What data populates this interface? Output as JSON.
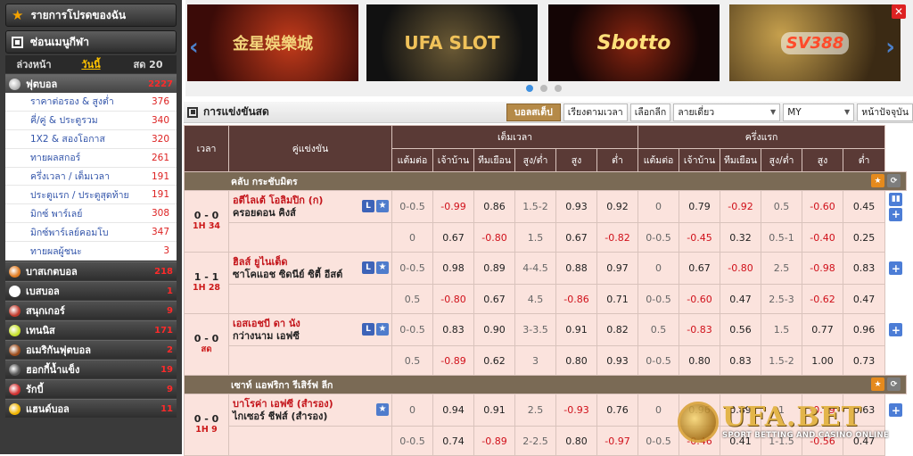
{
  "sidebar": {
    "favorites_label": "รายการโปรดของฉัน",
    "hide_menu_label": "ซ่อนเมนูกีฬา",
    "tabs": [
      {
        "label": "ล่วงหน้า",
        "active": false
      },
      {
        "label": "วันนี้",
        "active": true
      },
      {
        "label": "สด 20",
        "active": false
      }
    ],
    "active_sport": {
      "label": "ฟุตบอล",
      "count": "2227",
      "icon_color": "#ffffff"
    },
    "football_subs": [
      {
        "label": "ราคาต่อรอง & สูงต่ำ",
        "count": "376"
      },
      {
        "label": "คี่/คู่ & ประตูรวม",
        "count": "340"
      },
      {
        "label": "1X2 & สองโอกาส",
        "count": "320"
      },
      {
        "label": "ทายผลสกอร์",
        "count": "261"
      },
      {
        "label": "ครึ่งเวลา / เต็มเวลา",
        "count": "191"
      },
      {
        "label": "ประตูแรก / ประตูสุดท้าย",
        "count": "191"
      },
      {
        "label": "มิกซ์ พาร์เลย์",
        "count": "308"
      },
      {
        "label": "มิกซ์พาร์เลย์คอมโบ",
        "count": "347"
      },
      {
        "label": "ทายผลผู้ชนะ",
        "count": "3"
      }
    ],
    "sports": [
      {
        "label": "บาสเกตบอล",
        "count": "218",
        "icon_color": "#e07a1f",
        "icon": "basketball-icon"
      },
      {
        "label": "เบสบอล",
        "count": "1",
        "icon_color": "#ffffff",
        "icon": "baseball-icon"
      },
      {
        "label": "สนุกเกอร์",
        "count": "9",
        "icon_color": "#c0392b",
        "icon": "snooker-icon"
      },
      {
        "label": "เทนนิส",
        "count": "171",
        "icon_color": "#c6e02b",
        "icon": "tennis-icon"
      },
      {
        "label": "อเมริกันฟุตบอล",
        "count": "2",
        "icon_color": "#9a4a1a",
        "icon": "american-football-icon"
      },
      {
        "label": "ฮอกกี้น้ำแข็ง",
        "count": "19",
        "icon_color": "#555555",
        "icon": "ice-hockey-icon"
      },
      {
        "label": "รักบี้",
        "count": "9",
        "icon_color": "#d03030",
        "icon": "rugby-icon"
      },
      {
        "label": "แฮนด์บอล",
        "count": "11",
        "icon_color": "#f0b400",
        "icon": "handball-icon"
      }
    ]
  },
  "banners": [
    {
      "text": "金星娛樂城",
      "name": "banner-venus-casino"
    },
    {
      "text": "UFA SLOT",
      "name": "banner-ufaslot"
    },
    {
      "text": "Sbotto",
      "name": "banner-sbotto-casino"
    },
    {
      "text": "SV388",
      "name": "banner-sv388"
    }
  ],
  "live_bar": {
    "title": "การแข่งขันสด",
    "btn_live": "บอลสเต็ป",
    "btn_sort": "เรียงตามเวลา",
    "btn_select": "เลือกลีก",
    "odds_type": "ลายเดี่ยว",
    "odds_format": "MY",
    "btn_current": "หน้าปัจจุบัน"
  },
  "table": {
    "h_time": "เวลา",
    "h_match": "คู่แข่งขัน",
    "h_full": "เต็มเวลา",
    "h_half": "ครึ่งแรก",
    "sub_full": [
      "แต้มต่อ",
      "เจ้าบ้าน",
      "ทีมเยือน",
      "สูง/ต่ำ",
      "สูง",
      "ต่ำ"
    ],
    "sub_half": [
      "แต้มต่อ",
      "เจ้าบ้าน",
      "ทีมเยือน",
      "สูง/ต่ำ",
      "สูง",
      "ต่ำ"
    ],
    "leagues": [
      {
        "name": "คลับ กระชับมิตร",
        "matches": [
          {
            "score": "0 - 0",
            "minute": "1H 34",
            "home": "อตีไลเต้ โอลิมปิก (ก)",
            "away": "ครอยดอน คิงส์",
            "rows": [
              [
                "0-0.5",
                "-0.99",
                "0.86",
                "1.5-2",
                "0.93",
                "0.92",
                "0",
                "0.79",
                "-0.92",
                "0.5",
                "-0.60",
                "0.45"
              ],
              [
                "0",
                "0.67",
                "-0.80",
                "1.5",
                "0.67",
                "-0.82",
                "0-0.5",
                "-0.45",
                "0.32",
                "0.5-1",
                "-0.40",
                "0.25"
              ]
            ]
          },
          {
            "score": "1 - 1",
            "minute": "1H 28",
            "home": "ฮิลส์ ยูไนเต็ด",
            "away": "ซาโคแอช ซิดนีย์ ซิตี้ อีสต์",
            "rows": [
              [
                "0-0.5",
                "0.98",
                "0.89",
                "4-4.5",
                "0.88",
                "0.97",
                "0",
                "0.67",
                "-0.80",
                "2.5",
                "-0.98",
                "0.83"
              ],
              [
                "0.5",
                "-0.80",
                "0.67",
                "4.5",
                "-0.86",
                "0.71",
                "0-0.5",
                "-0.60",
                "0.47",
                "2.5-3",
                "-0.62",
                "0.47"
              ]
            ]
          },
          {
            "score": "0 - 0",
            "minute": "สด",
            "home": "เอสเอชบี ดา นัง",
            "away": "กว่างนาม เอฟซี",
            "rows": [
              [
                "0-0.5",
                "0.83",
                "0.90",
                "3-3.5",
                "0.91",
                "0.82",
                "0.5",
                "-0.83",
                "0.56",
                "1.5",
                "0.77",
                "0.96"
              ],
              [
                "0.5",
                "-0.89",
                "0.62",
                "3",
                "0.80",
                "0.93",
                "0-0.5",
                "0.80",
                "0.83",
                "1.5-2",
                "1.00",
                "0.73"
              ]
            ]
          }
        ]
      },
      {
        "name": "เซาท์ แอฟริกา รีเสิร์ฟ ลีก",
        "matches": [
          {
            "score": "0 - 0",
            "minute": "1H 9",
            "home": "บาโรค่า เอฟซี (สำรอง)",
            "away": "ไกเซอร์ ชีฟส์ (สำรอง)",
            "rows": [
              [
                "0",
                "0.94",
                "0.91",
                "2.5",
                "-0.93",
                "0.76",
                "0",
                "0.96",
                "0.89",
                "1",
                "-0.79",
                "0.63"
              ],
              [
                "0-0.5",
                "0.74",
                "-0.89",
                "2-2.5",
                "0.80",
                "-0.97",
                "0-0.5",
                "-0.46",
                "0.41",
                "1-1.5",
                "-0.56",
                "0.47"
              ]
            ]
          }
        ]
      }
    ]
  },
  "watermark": {
    "big": "UFA.BET",
    "small": "SPORT BETTING AND CASINO ONLINE"
  }
}
